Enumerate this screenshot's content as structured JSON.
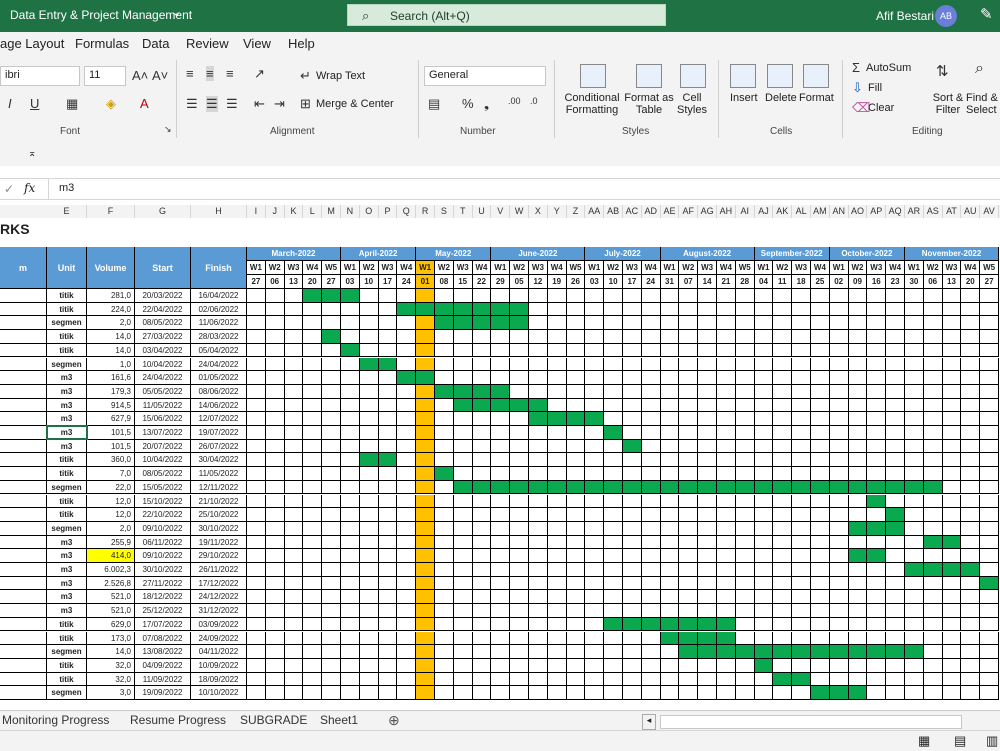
{
  "titlebar": {
    "document": "Data Entry & Project Management",
    "search": "Search (Alt+Q)",
    "user": "Afif Bestari",
    "initials": "AB"
  },
  "ribbon_tabs": [
    "age Layout",
    "Formulas",
    "Data",
    "Review",
    "View",
    "Help"
  ],
  "ribbon": {
    "font_name": "ibri",
    "font_size": "11",
    "number_format": "General",
    "wrap_text": "Wrap Text",
    "merge_center": "Merge & Center",
    "conditional_formatting": "Conditional Formatting",
    "format_as_table": "Format as Table",
    "cell_styles": "Cell Styles",
    "insert": "Insert",
    "delete": "Delete",
    "format": "Format",
    "autosum": "AutoSum",
    "fill": "Fill",
    "clear": "Clear",
    "sort_filter": "Sort & Filter",
    "find_select": "Find & Select",
    "groups": {
      "font": "Font",
      "alignment": "Alignment",
      "number": "Number",
      "styles": "Styles",
      "cells": "Cells",
      "editing": "Editing"
    }
  },
  "formula_bar": {
    "value": "m3"
  },
  "columns": [
    "E",
    "F",
    "G",
    "H",
    "I",
    "J",
    "K",
    "L",
    "M",
    "N",
    "O",
    "P",
    "Q",
    "R",
    "S",
    "T",
    "U",
    "V",
    "W",
    "X",
    "Y",
    "Z",
    "AA",
    "AB",
    "AC",
    "AD",
    "AE",
    "AF",
    "AG",
    "AH",
    "AI",
    "AJ",
    "AK",
    "AL",
    "AM",
    "AN",
    "AO",
    "AP",
    "AQ",
    "AR",
    "AS",
    "AT",
    "AU",
    "AV"
  ],
  "sheet_title": "RKS",
  "headers": {
    "item": "m",
    "unit": "Unit",
    "volume": "Volume",
    "start": "Start",
    "finish": "Finish"
  },
  "months": [
    "March-2022",
    "April-2022",
    "May-2022",
    "June-2022",
    "July-2022",
    "August-2022",
    "September-2022",
    "October-2022",
    "November-2022"
  ],
  "weeks": [
    "W1",
    "W2",
    "W3",
    "W4",
    "W5",
    "W1",
    "W2",
    "W3",
    "W4",
    "W1",
    "W2",
    "W3",
    "W4",
    "W1",
    "W2",
    "W3",
    "W4",
    "W5",
    "W1",
    "W2",
    "W3",
    "W4",
    "W1",
    "W2",
    "W3",
    "W4",
    "W5",
    "W1",
    "W2",
    "W3",
    "W4",
    "W1",
    "W2",
    "W3",
    "W4",
    "W1",
    "W2",
    "W3",
    "W4",
    "W5"
  ],
  "dates": [
    "27",
    "06",
    "13",
    "20",
    "27",
    "03",
    "10",
    "17",
    "24",
    "01",
    "08",
    "15",
    "22",
    "29",
    "05",
    "12",
    "19",
    "26",
    "03",
    "10",
    "17",
    "24",
    "31",
    "07",
    "14",
    "21",
    "28",
    "04",
    "11",
    "18",
    "25",
    "02",
    "09",
    "16",
    "23",
    "30",
    "06",
    "13",
    "20",
    "27"
  ],
  "rows": [
    {
      "unit": "titik",
      "volume": "281,0",
      "start": "20/03/2022",
      "finish": "16/04/2022"
    },
    {
      "unit": "titik",
      "volume": "224,0",
      "start": "22/04/2022",
      "finish": "02/06/2022"
    },
    {
      "unit": "segmen",
      "volume": "2,0",
      "start": "08/05/2022",
      "finish": "11/06/2022"
    },
    {
      "unit": "titik",
      "volume": "14,0",
      "start": "27/03/2022",
      "finish": "28/03/2022"
    },
    {
      "unit": "titik",
      "volume": "14,0",
      "start": "03/04/2022",
      "finish": "05/04/2022"
    },
    {
      "unit": "segmen",
      "volume": "1,0",
      "start": "10/04/2022",
      "finish": "24/04/2022"
    },
    {
      "unit": "m3",
      "volume": "161,6",
      "start": "24/04/2022",
      "finish": "01/05/2022"
    },
    {
      "unit": "m3",
      "volume": "179,3",
      "start": "05/05/2022",
      "finish": "08/06/2022"
    },
    {
      "unit": "m3",
      "volume": "914,5",
      "start": "11/05/2022",
      "finish": "14/06/2022"
    },
    {
      "unit": "m3",
      "volume": "627,9",
      "start": "15/06/2022",
      "finish": "12/07/2022"
    },
    {
      "unit": "m3",
      "volume": "101,5",
      "start": "13/07/2022",
      "finish": "19/07/2022"
    },
    {
      "unit": "m3",
      "volume": "101,5",
      "start": "20/07/2022",
      "finish": "26/07/2022"
    },
    {
      "unit": "titik",
      "volume": "360,0",
      "start": "10/04/2022",
      "finish": "30/04/2022"
    },
    {
      "unit": "titik",
      "volume": "7,0",
      "start": "08/05/2022",
      "finish": "11/05/2022"
    },
    {
      "unit": "segmen",
      "volume": "22,0",
      "start": "15/05/2022",
      "finish": "12/11/2022"
    },
    {
      "unit": "titik",
      "volume": "12,0",
      "start": "15/10/2022",
      "finish": "21/10/2022"
    },
    {
      "unit": "titik",
      "volume": "12,0",
      "start": "22/10/2022",
      "finish": "25/10/2022"
    },
    {
      "unit": "segmen",
      "volume": "2,0",
      "start": "09/10/2022",
      "finish": "30/10/2022"
    },
    {
      "unit": "m3",
      "volume": "255,9",
      "start": "06/11/2022",
      "finish": "19/11/2022"
    },
    {
      "unit": "m3",
      "volume": "414,0",
      "start": "09/10/2022",
      "finish": "29/10/2022"
    },
    {
      "unit": "m3",
      "volume": "6.002,3",
      "start": "30/10/2022",
      "finish": "26/11/2022"
    },
    {
      "unit": "m3",
      "volume": "2.526,8",
      "start": "27/11/2022",
      "finish": "17/12/2022"
    },
    {
      "unit": "m3",
      "volume": "521,0",
      "start": "18/12/2022",
      "finish": "24/12/2022"
    },
    {
      "unit": "m3",
      "volume": "521,0",
      "start": "25/12/2022",
      "finish": "31/12/2022"
    },
    {
      "unit": "titik",
      "volume": "629,0",
      "start": "17/07/2022",
      "finish": "03/09/2022"
    },
    {
      "unit": "titik",
      "volume": "173,0",
      "start": "07/08/2022",
      "finish": "24/09/2022"
    },
    {
      "unit": "segmen",
      "volume": "14,0",
      "start": "13/08/2022",
      "finish": "04/11/2022"
    },
    {
      "unit": "titik",
      "volume": "32,0",
      "start": "04/09/2022",
      "finish": "10/09/2022"
    },
    {
      "unit": "titik",
      "volume": "32,0",
      "start": "11/09/2022",
      "finish": "18/09/2022"
    },
    {
      "unit": "segmen",
      "volume": "3,0",
      "start": "19/09/2022",
      "finish": "10/10/2022"
    }
  ],
  "gantt_bars": [
    [
      [
        3,
        5
      ]
    ],
    [
      [
        8,
        14
      ]
    ],
    [
      [
        10,
        14
      ]
    ],
    [
      [
        4,
        4
      ]
    ],
    [
      [
        5,
        5
      ]
    ],
    [
      [
        6,
        7
      ]
    ],
    [
      [
        8,
        9
      ]
    ],
    [
      [
        10,
        13
      ]
    ],
    [
      [
        11,
        15
      ]
    ],
    [
      [
        15,
        18
      ]
    ],
    [
      [
        19,
        19
      ]
    ],
    [
      [
        20,
        20
      ]
    ],
    [
      [
        6,
        7
      ]
    ],
    [
      [
        10,
        10
      ]
    ],
    [
      [
        11,
        36
      ]
    ],
    [
      [
        33,
        33
      ]
    ],
    [
      [
        34,
        34
      ]
    ],
    [
      [
        32,
        34
      ]
    ],
    [
      [
        36,
        37
      ]
    ],
    [
      [
        32,
        33
      ]
    ],
    [
      [
        35,
        38
      ]
    ],
    [
      [
        39,
        39
      ]
    ],
    [],
    [],
    [
      [
        19,
        25
      ]
    ],
    [
      [
        22,
        25
      ]
    ],
    [
      [
        23,
        35
      ]
    ],
    [
      [
        27,
        27
      ]
    ],
    [
      [
        28,
        29
      ]
    ],
    [
      [
        30,
        32
      ]
    ]
  ],
  "sheet_tabs": [
    "Monitoring Progress",
    "Resume Progress",
    "SUBGRADE",
    "Sheet1"
  ]
}
